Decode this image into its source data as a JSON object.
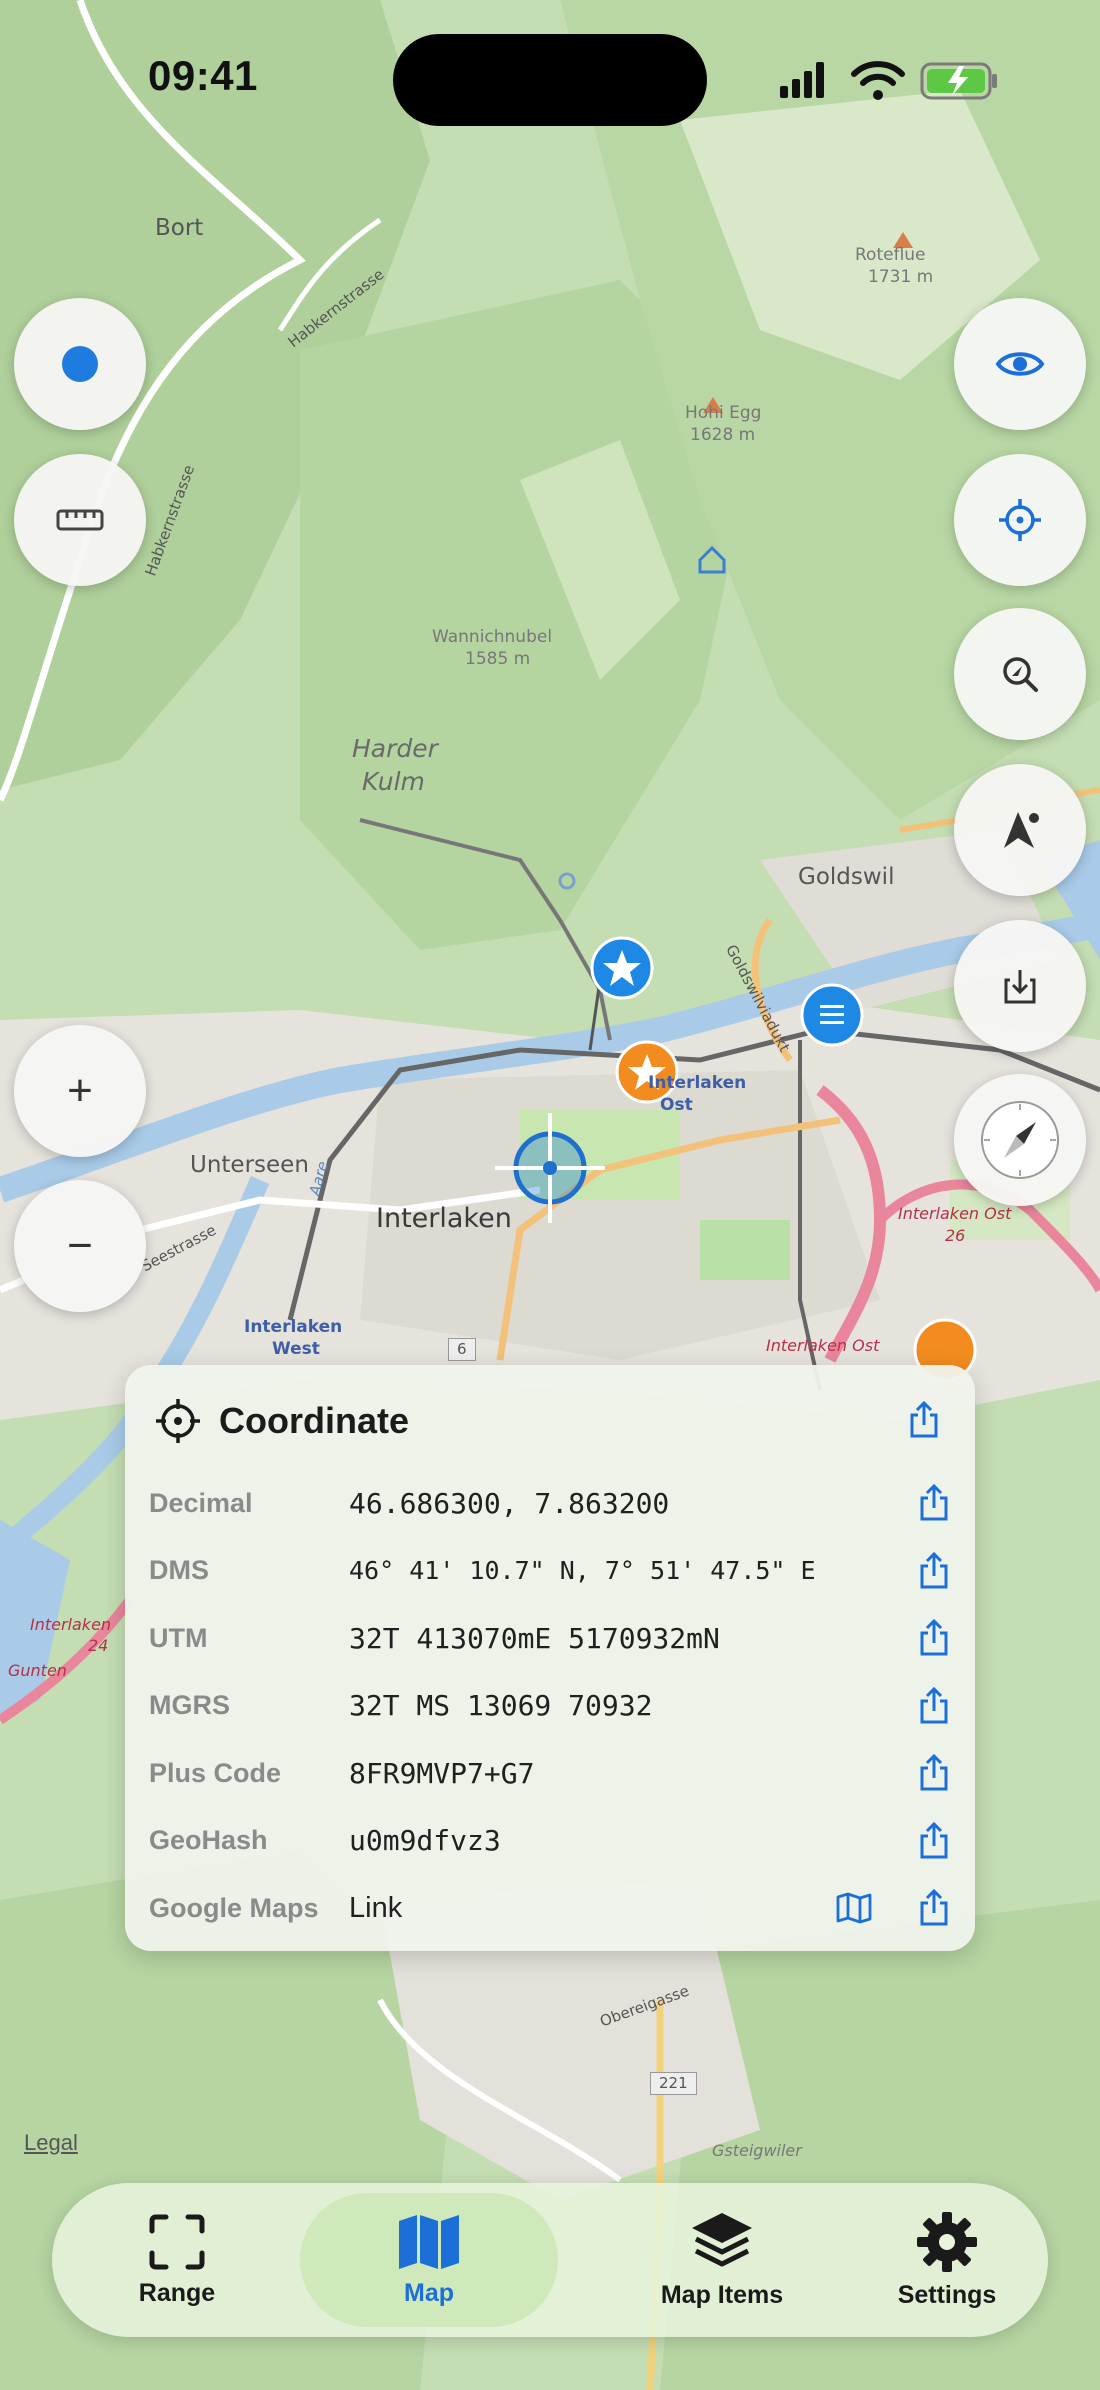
{
  "status_bar": {
    "time": "09:41"
  },
  "map": {
    "labels": {
      "bort": "Bort",
      "roteflue": "Roteflue",
      "roteflue_elev": "1731 m",
      "hohi_egg": "Hohi Egg",
      "hohi_egg_elev": "1628 m",
      "wannichnubel": "Wannichnubel",
      "wannichnubel_elev": "1585 m",
      "harder": "Harder",
      "kulm": "Kulm",
      "goldswil": "Goldswil",
      "unterseen": "Unterseen",
      "interlaken": "Interlaken",
      "interlaken_west_1": "Interlaken",
      "interlaken_west_2": "West",
      "interlaken_ost_1": "Interlaken",
      "interlaken_ost_2": "Ost",
      "exit_ost_26": "Interlaken Ost",
      "exit_ost_26_num": "26",
      "exit_ost": "Interlaken Ost",
      "exit_24": "Interlaken",
      "exit_24_num": "24",
      "gunten": "Gunten",
      "road_6": "6",
      "road_221": "221",
      "gsteigwiler": "Gsteigwiler",
      "obereigasse": "Obereigasse",
      "habkernstrasse_1": "Habkernstrasse",
      "habkernstrasse_2": "Habkernstrasse",
      "seestrasse": "Seestrasse",
      "goldswil_viadukt": "Goldswilviadukt",
      "aare": "Aare"
    }
  },
  "buttons": {
    "location_dot": "location-dot",
    "ruler": "ruler",
    "visibility": "eye",
    "crosshair": "crosshair",
    "search_location": "search",
    "navigate": "navigation-arrow",
    "download": "download",
    "compass": "compass",
    "zoom_in": "+",
    "zoom_out": "−"
  },
  "coordinate_card": {
    "title": "Coordinate",
    "rows": [
      {
        "label": "Decimal",
        "value": "46.686300, 7.863200"
      },
      {
        "label": "DMS",
        "value": "46° 41' 10.7\" N, 7° 51' 47.5\" E"
      },
      {
        "label": "UTM",
        "value": "32T 413070mE 5170932mN"
      },
      {
        "label": "MGRS",
        "value": "32T MS 13069 70932"
      },
      {
        "label": "Plus Code",
        "value": "8FR9MVP7+G7"
      },
      {
        "label": "GeoHash",
        "value": "u0m9dfvz3"
      },
      {
        "label": "Google Maps",
        "value": "Link"
      }
    ]
  },
  "legal": "Legal",
  "tabs": [
    {
      "label": "Range",
      "icon": "viewfinder-icon"
    },
    {
      "label": "Map",
      "icon": "map-icon",
      "active": true
    },
    {
      "label": "Map Items",
      "icon": "layers-icon"
    },
    {
      "label": "Settings",
      "icon": "gear-icon"
    }
  ],
  "colors": {
    "accent": "#1d6fd8",
    "marker_blue": "#1e88e5",
    "marker_orange": "#f28c1e"
  }
}
